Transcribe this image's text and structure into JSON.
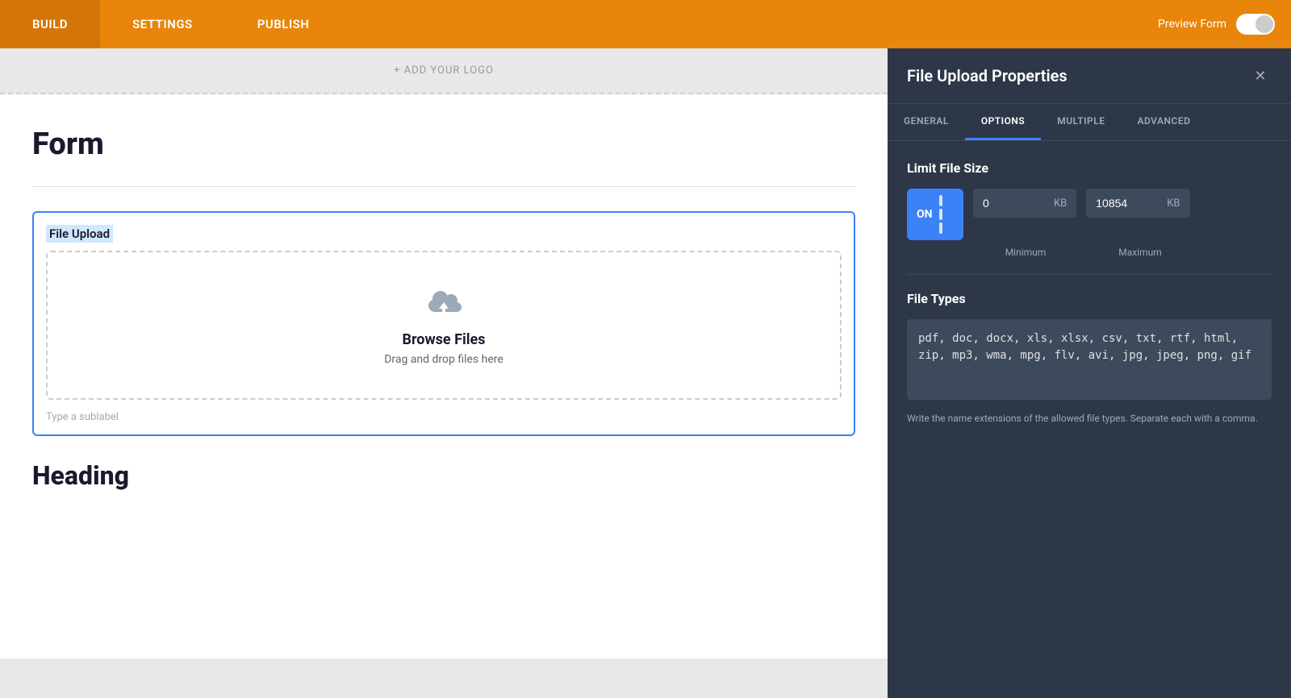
{
  "nav": {
    "tabs": [
      {
        "label": "BUILD",
        "active": true
      },
      {
        "label": "SETTINGS",
        "active": false
      },
      {
        "label": "PUBLISH",
        "active": false
      }
    ],
    "preview_label": "Preview Form"
  },
  "logo_bar": {
    "text": "+ ADD YOUR LOGO"
  },
  "form": {
    "title": "Form",
    "file_upload_label": "File Upload",
    "browse_files": "Browse Files",
    "drag_drop": "Drag and drop files here",
    "sublabel_placeholder": "Type a sublabel",
    "heading": "Heading"
  },
  "panel": {
    "title": "File Upload Properties",
    "close_icon": "✕",
    "tabs": [
      {
        "label": "GENERAL",
        "active": false
      },
      {
        "label": "OPTIONS",
        "active": true
      },
      {
        "label": "MULTIPLE",
        "active": false
      },
      {
        "label": "ADVANCED",
        "active": false
      }
    ],
    "limit_file_size": {
      "section_title": "Limit File Size",
      "toggle_label": "ON",
      "min_value": "0",
      "min_unit": "KB",
      "min_label": "Minimum",
      "max_value": "10854",
      "max_unit": "KB",
      "max_label": "Maximum"
    },
    "file_types": {
      "section_title": "File Types",
      "value": "pdf, doc, docx, xls, xlsx, csv, txt, rtf, html, zip, mp3, wma, mpg, flv, avi, jpg, jpeg, png, gif",
      "hint": "Write the name extensions of the allowed file types. Separate each with a comma."
    }
  }
}
